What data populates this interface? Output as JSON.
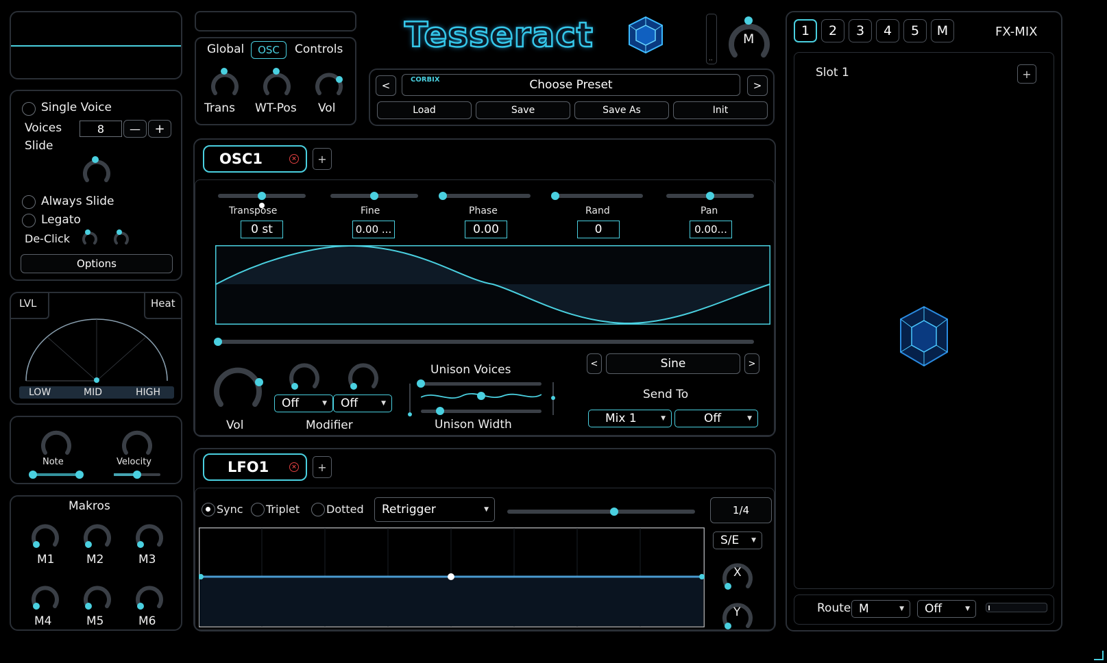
{
  "header": {
    "title": "Tesseract",
    "master_knob_label": "M"
  },
  "top_tabs": {
    "items": [
      "Global",
      "OSC",
      "Controls"
    ],
    "active": "OSC"
  },
  "global_knobs": [
    "Trans",
    "WT-Pos",
    "Vol"
  ],
  "preset": {
    "brand": "CORBIX",
    "name": "Choose Preset",
    "prev": "<",
    "next": ">",
    "buttons": [
      "Load",
      "Save",
      "Save As",
      "Init"
    ]
  },
  "voice": {
    "single_voice": "Single Voice",
    "voices_label": "Voices",
    "voices_value": "8",
    "minus": "—",
    "plus": "+",
    "slide": "Slide",
    "always_slide": "Always Slide",
    "legato": "Legato",
    "declick": "De-Click",
    "options": "Options"
  },
  "level": {
    "lvl": "LVL",
    "heat": "Heat",
    "bands": [
      "LOW",
      "MID",
      "HIGH"
    ]
  },
  "note_velocity": {
    "note": "Note",
    "velocity": "Velocity"
  },
  "makros": {
    "title": "Makros",
    "items": [
      "M1",
      "M2",
      "M3",
      "M4",
      "M5",
      "M6"
    ]
  },
  "osc": {
    "tab_label": "OSC1",
    "add": "+",
    "params": [
      {
        "label": "Transpose",
        "value": "0 st"
      },
      {
        "label": "Fine",
        "value": "0.00 ..."
      },
      {
        "label": "Phase",
        "value": "0.00"
      },
      {
        "label": "Rand",
        "value": "0"
      },
      {
        "label": "Pan",
        "value": "0.00..."
      }
    ],
    "vol_label": "Vol",
    "modifier_label": "Modifier",
    "modifier_values": [
      "Off",
      "Off"
    ],
    "unison_voices": "Unison Voices",
    "unison_width": "Unison Width",
    "waveform": "Sine",
    "wave_prev": "<",
    "wave_next": ">",
    "send_to": "Send To",
    "send_values": [
      "Mix 1",
      "Off"
    ],
    "accent": "#4ad0e0"
  },
  "lfo": {
    "tab_label": "LFO1",
    "add": "+",
    "sync": "Sync",
    "triplet": "Triplet",
    "dotted": "Dotted",
    "mode": "Retrigger",
    "rate": "1/4",
    "se": "S/E",
    "x": "X",
    "y": "Y"
  },
  "fx": {
    "slots": [
      "1",
      "2",
      "3",
      "4",
      "5",
      "M"
    ],
    "active_slot": "1",
    "label": "FX-MIX",
    "slot_title": "Slot 1",
    "add": "+",
    "route_label": "Route",
    "route_values": [
      "M",
      "Off"
    ]
  }
}
